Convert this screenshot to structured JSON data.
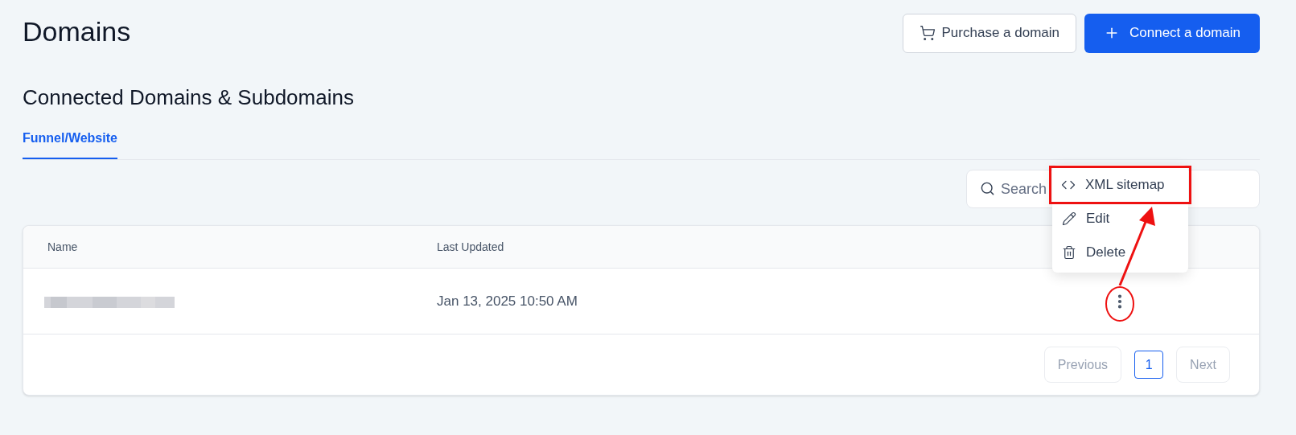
{
  "page": {
    "title": "Domains"
  },
  "actions": [
    {
      "kind": "outline",
      "label": "Purchase a domain"
    },
    {
      "kind": "primary",
      "label": "Connect a domain"
    }
  ],
  "section": {
    "title": "Connected Domains & Subdomains"
  },
  "tabs": [
    {
      "label": "Funnel/Website",
      "selected": true
    }
  ],
  "search": {
    "placeholder": "Search"
  },
  "table": {
    "columns": [
      "Name",
      "Last Updated"
    ],
    "rows": [
      {
        "name_blurred": true,
        "last_updated": "Jan 13, 2025 10:50 AM"
      }
    ]
  },
  "menu": {
    "items": [
      {
        "kind": "code",
        "label": "XML sitemap",
        "highlighted": true
      },
      {
        "kind": "edit",
        "label": "Edit",
        "highlighted": false
      },
      {
        "kind": "delete",
        "label": "Delete",
        "highlighted": false
      }
    ]
  },
  "pagination": {
    "previous": {
      "label": "Previous",
      "disabled": true
    },
    "pages": [
      {
        "label": "1",
        "selected": true
      }
    ],
    "next": {
      "label": "Next",
      "disabled": true
    }
  }
}
